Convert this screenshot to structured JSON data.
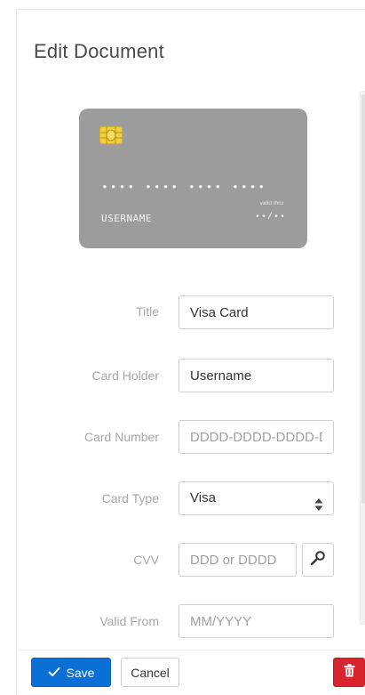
{
  "dialog": {
    "title": "Edit Document"
  },
  "card_preview": {
    "chip_icon": "card-chip-icon",
    "number_mask": "•••• •••• •••• ••••",
    "holder": "USERNAME",
    "valid_thru_label": "valid thru",
    "valid_thru_value": "••/••",
    "background_color": "#9c9c9c"
  },
  "form": {
    "title": {
      "label": "Title",
      "value": "Visa Card"
    },
    "card_holder": {
      "label": "Card Holder",
      "value": "Username"
    },
    "card_number": {
      "label": "Card Number",
      "placeholder": "DDDD-DDDD-DDDD-DDDD",
      "value": ""
    },
    "card_type": {
      "label": "Card Type",
      "selected": "Visa",
      "icon": "select-arrows-icon"
    },
    "cvv": {
      "label": "CVV",
      "placeholder": "DDD or DDDD",
      "value": "",
      "generate_icon": "key-icon"
    },
    "valid_from": {
      "label": "Valid From",
      "placeholder": "MM/YYYY",
      "value": ""
    }
  },
  "footer": {
    "save_label": "Save",
    "save_icon": "checkmark-icon",
    "cancel_label": "Cancel",
    "delete_icon": "trash-icon",
    "primary_color": "#0a6fd6",
    "danger_color": "#d9232e"
  }
}
